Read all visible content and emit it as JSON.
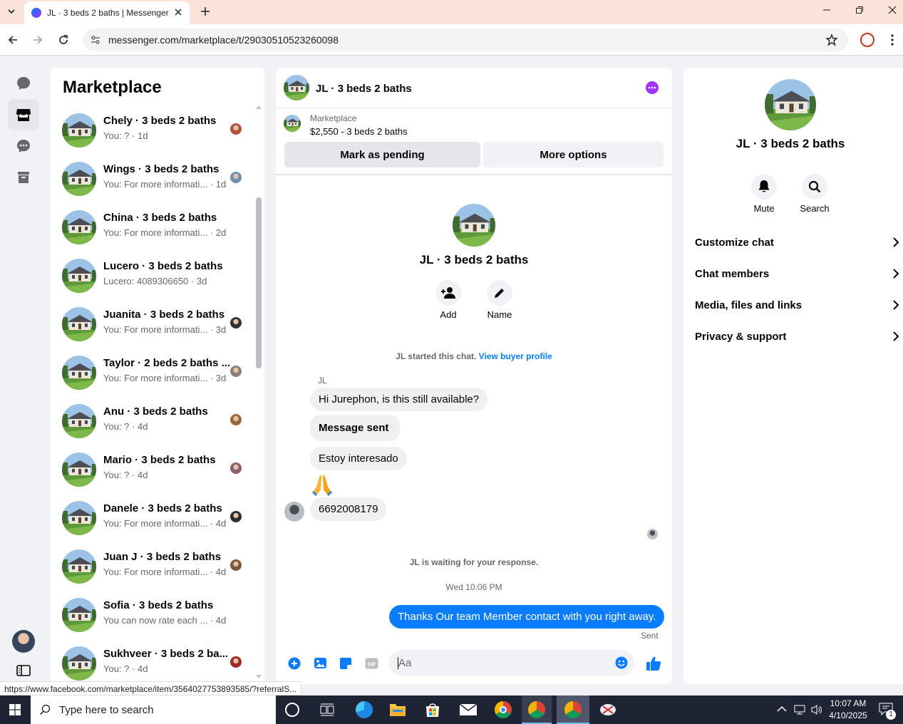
{
  "browser": {
    "tab_title": "JL · 3 beds 2 baths | Messenger",
    "url": "messenger.com/marketplace/t/29030510523260098",
    "status_url": "https://www.facebook.com/marketplace/item/3564027753893585/?referralS..."
  },
  "sidebar": {
    "title": "Marketplace"
  },
  "conversations": [
    {
      "name": "Chely · 3 beds 2 baths",
      "preview": "You: ?",
      "time": "1d",
      "avatar_color": "#b5523b"
    },
    {
      "name": "Wings · 3 beds 2 baths",
      "preview": "You: For more informati...",
      "time": "1d",
      "avatar_color": "#6f8fb0"
    },
    {
      "name": "China · 3 beds 2 baths",
      "preview": "You: For more informati...",
      "time": "2d",
      "avatar_color": ""
    },
    {
      "name": "Lucero · 3 beds 2 baths",
      "preview": "Lucero: 4089306650",
      "time": "3d",
      "avatar_color": ""
    },
    {
      "name": "Juanita · 3 beds 2 baths",
      "preview": "You: For more informati...",
      "time": "3d",
      "avatar_color": "#333333"
    },
    {
      "name": "Taylor · 2 beds 2 baths ...",
      "preview": "You: For more informati...",
      "time": "3d",
      "avatar_color": "#8a7f7a"
    },
    {
      "name": "Anu · 3 beds 2 baths",
      "preview": "You: ?",
      "time": "4d",
      "avatar_color": "#9b6a3c"
    },
    {
      "name": "Mario · 3 beds 2 baths",
      "preview": "You: ?",
      "time": "4d",
      "avatar_color": "#8d5e6c"
    },
    {
      "name": "Danele · 3 beds 2 baths",
      "preview": "You: For more informati...",
      "time": "4d",
      "avatar_color": "#2e2e2e"
    },
    {
      "name": "Juan J · 3 beds 2 baths",
      "preview": "You: For more informati...",
      "time": "4d",
      "avatar_color": "#7a5a3a"
    },
    {
      "name": "Sofia · 3 beds 2 baths",
      "preview": "You can now rate each ...",
      "time": "4d",
      "avatar_color": ""
    },
    {
      "name": "Sukhveer · 3 beds 2 ba...",
      "preview": "You: ?",
      "time": "4d",
      "avatar_color": "#a02a2a"
    }
  ],
  "chat": {
    "title": "JL · 3 beds 2 baths",
    "listing_label": "Marketplace",
    "listing_price": "$2,550 - 3 beds 2 baths",
    "mark_pending": "Mark as pending",
    "more_options": "More options",
    "profile_name": "JL · 3 beds 2 baths",
    "add_label": "Add",
    "name_label": "Name",
    "started_text": "JL started this chat.",
    "view_buyer": "View buyer profile",
    "sender_label": "JL",
    "messages": [
      "Hi Jurephon, is this still available?",
      "Message sent",
      "Estoy interesado",
      "🙏",
      "6692008179"
    ],
    "waiting_text": "JL is waiting for your response.",
    "timestamp": "Wed 10:06 PM",
    "outgoing": "Thanks Our team Member contact with you right away.",
    "sent_label": "Sent",
    "input_placeholder": "Aa"
  },
  "info": {
    "name": "JL · 3 beds 2 baths",
    "mute": "Mute",
    "search": "Search",
    "rows": [
      "Customize chat",
      "Chat members",
      "Media, files and links",
      "Privacy & support"
    ]
  },
  "taskbar": {
    "search_placeholder": "Type here to search",
    "time": "10:07 AM",
    "date": "4/10/2025",
    "notif_count": "1"
  },
  "colors": {
    "accent": "#0a7cff",
    "purple": "#a033ff"
  }
}
